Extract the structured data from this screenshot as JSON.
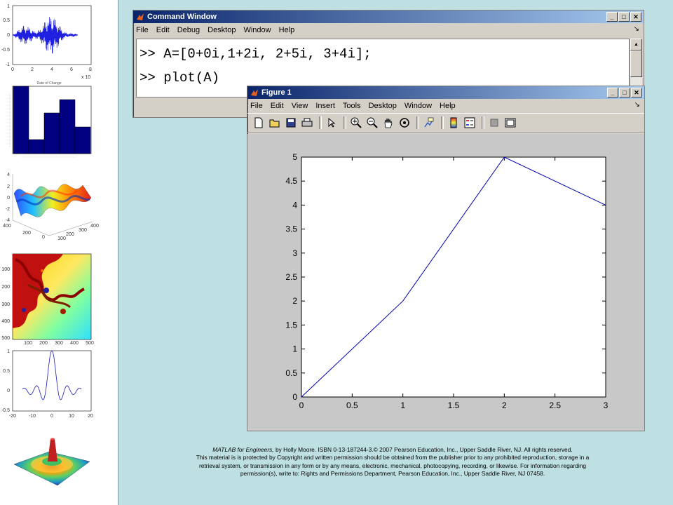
{
  "command_window": {
    "title": "Command Window",
    "menus": [
      "File",
      "Edit",
      "Debug",
      "Desktop",
      "Window",
      "Help"
    ],
    "lines": [
      ">> A=[0+0i,1+2i, 2+5i, 3+4i];",
      ">> plot(A)"
    ]
  },
  "figure_window": {
    "title": "Figure 1",
    "menus": [
      "File",
      "Edit",
      "View",
      "Insert",
      "Tools",
      "Desktop",
      "Window",
      "Help"
    ],
    "toolbar_icons": [
      "new-file-icon",
      "open-folder-icon",
      "save-icon",
      "print-icon",
      "pointer-icon",
      "zoom-in-icon",
      "zoom-out-icon",
      "pan-hand-icon",
      "rotate-3d-icon",
      "data-cursor-icon",
      "colorbar-icon",
      "legend-icon",
      "hide-plot-tools-icon",
      "show-plot-tools-icon"
    ]
  },
  "window_buttons": {
    "minimize": "_",
    "maximize": "□",
    "close": "✕"
  },
  "chart_data": {
    "type": "line",
    "x": [
      0,
      1,
      2,
      3
    ],
    "y": [
      0,
      2,
      5,
      4
    ],
    "xlim": [
      0,
      3
    ],
    "ylim": [
      0,
      5
    ],
    "xticks": [
      "0",
      "0.5",
      "1",
      "1.5",
      "2",
      "2.5",
      "3"
    ],
    "yticks": [
      "0",
      "0.5",
      "1",
      "1.5",
      "2",
      "2.5",
      "3",
      "3.5",
      "4",
      "4.5",
      "5"
    ],
    "line_color": "#0000aa",
    "grid": false
  },
  "sidebar": {
    "plot1": {
      "yticks": [
        "1",
        "0.5",
        "0",
        "-0.5",
        "-1"
      ],
      "xticks": [
        "0",
        "2",
        "4",
        "6",
        "8"
      ],
      "exponent": "x 10"
    },
    "plot2": {
      "title": "Rate of Change"
    },
    "plot3": {
      "zticks": [
        "4",
        "2",
        "0",
        "-2",
        "-4"
      ],
      "xticks": [
        "200",
        "100",
        "0"
      ],
      "yticks": [
        "200",
        "300",
        "400"
      ],
      "corner": "400",
      "base": "0"
    },
    "plot4": {
      "yticks": [
        "100",
        "200",
        "300",
        "400",
        "500"
      ],
      "xticks": [
        "100",
        "200",
        "300",
        "400",
        "500"
      ]
    },
    "plot5": {
      "yticks": [
        "1",
        "0.5",
        "0",
        "-0.5"
      ],
      "xticks": [
        "-20",
        "-10",
        "0",
        "10",
        "20"
      ]
    }
  },
  "caption": {
    "book_title": "MATLAB for Engineers,",
    "line1": " by Holly Moore. ISBN 0-13-187244-3.© 2007 Pearson Education, Inc., Upper Saddle River, NJ.  All rights reserved.",
    "line2": "This material is is protected by Copyright and written permission should be obtained from the publisher prior to any prohibited reproduction, storage in a",
    "line3": "retrieval system, or transmission in any form or by any means, electronic, mechanical, photocopying, recording, or likewise. For information regarding",
    "line4": "permission(s), write to: Rights and Permissions Department, Pearson Education, Inc., Upper Saddle River, NJ 07458."
  }
}
